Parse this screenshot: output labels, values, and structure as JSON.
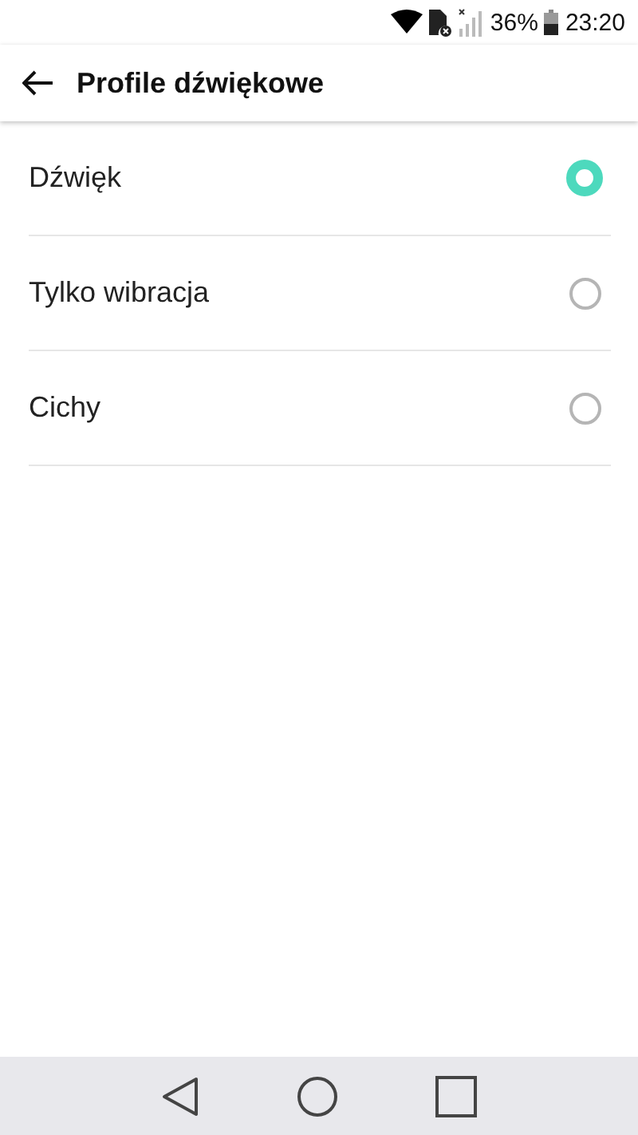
{
  "status_bar": {
    "battery": "36%",
    "time": "23:20"
  },
  "app_bar": {
    "title": "Profile dźwiękowe"
  },
  "options": [
    {
      "label": "Dźwięk",
      "selected": true
    },
    {
      "label": "Tylko wibracja",
      "selected": false
    },
    {
      "label": "Cichy",
      "selected": false
    }
  ]
}
